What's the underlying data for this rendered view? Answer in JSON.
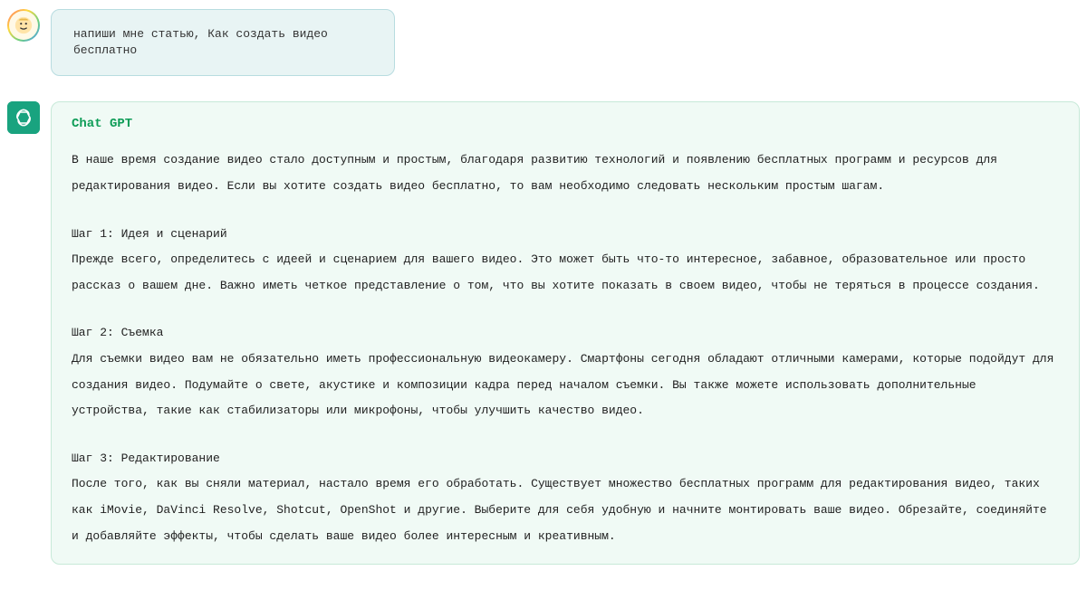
{
  "user_message": {
    "text": "напиши мне статью, Как создать видео бесплатно"
  },
  "bot_message": {
    "name": "Chat GPT",
    "intro": "В наше время создание видео стало доступным и простым, благодаря развитию технологий и появлению бесплатных программ и ресурсов для редактирования видео. Если вы хотите создать видео бесплатно, то вам необходимо следовать нескольким простым шагам.",
    "step1_title": "Шаг 1: Идея и сценарий",
    "step1_body": "Прежде всего, определитесь с идеей и сценарием для вашего видео. Это может быть что-то интересное, забавное, образовательное или просто рассказ о вашем дне. Важно иметь четкое представление о том, что вы хотите показать в своем видео, чтобы не теряться в процессе создания.",
    "step2_title": "Шаг 2: Съемка",
    "step2_body": "Для съемки видео вам не обязательно иметь профессиональную видеокамеру. Смартфоны сегодня обладают отличными камерами, которые подойдут для создания видео. Подумайте о свете, акустике и композиции кадра перед началом съемки. Вы также можете использовать дополнительные устройства, такие как стабилизаторы или микрофоны, чтобы улучшить качество видео.",
    "step3_title": "Шаг 3: Редактирование",
    "step3_body": "После того, как вы сняли материал, настало время его обработать. Существует множество бесплатных программ для редактирования видео, таких как iMovie, DaVinci Resolve, Shotcut, OpenShot и другие. Выберите для себя удобную и начните монтировать ваше видео. Обрезайте, соединяйте и добавляйте эффекты, чтобы сделать ваше видео более интересным и креативным."
  }
}
